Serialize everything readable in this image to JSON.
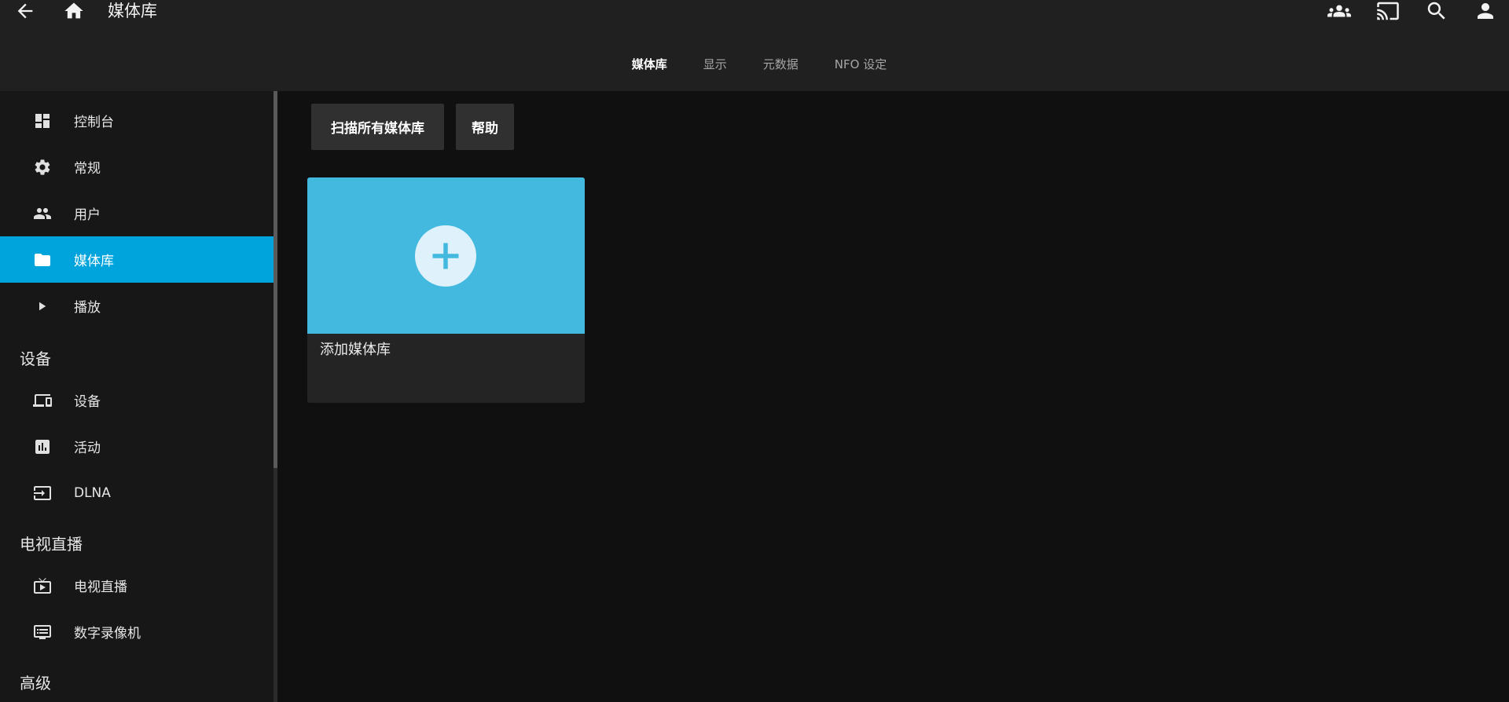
{
  "header": {
    "title": "媒体库",
    "back_icon": "arrow-back-icon",
    "home_icon": "home-icon",
    "right_icons": [
      "people-icon",
      "cast-icon",
      "search-icon",
      "user-icon"
    ]
  },
  "tabs": [
    {
      "label": "媒体库",
      "active": true
    },
    {
      "label": "显示",
      "active": false
    },
    {
      "label": "元数据",
      "active": false
    },
    {
      "label": "NFO 设定",
      "active": false
    }
  ],
  "sidebar": {
    "items": [
      {
        "label": "控制台",
        "icon": "dashboard-icon"
      },
      {
        "label": "常规",
        "icon": "gear-icon"
      },
      {
        "label": "用户",
        "icon": "people-icon"
      },
      {
        "label": "媒体库",
        "icon": "folder-icon",
        "active": true
      },
      {
        "label": "播放",
        "icon": "play-icon"
      }
    ],
    "section_devices": "设备",
    "device_items": [
      {
        "label": "设备",
        "icon": "devices-icon"
      },
      {
        "label": "活动",
        "icon": "activity-chart-icon"
      },
      {
        "label": "DLNA",
        "icon": "input-icon"
      }
    ],
    "section_livetv": "电视直播",
    "livetv_items": [
      {
        "label": "电视直播",
        "icon": "live-tv-icon"
      },
      {
        "label": "数字录像机",
        "icon": "dvr-icon"
      }
    ],
    "section_advanced": "高级"
  },
  "main": {
    "scan_button": "扫描所有媒体库",
    "help_button": "帮助",
    "add_card_label": "添加媒体库",
    "accent_color": "#00a4dc",
    "card_color": "#44b9e0"
  }
}
